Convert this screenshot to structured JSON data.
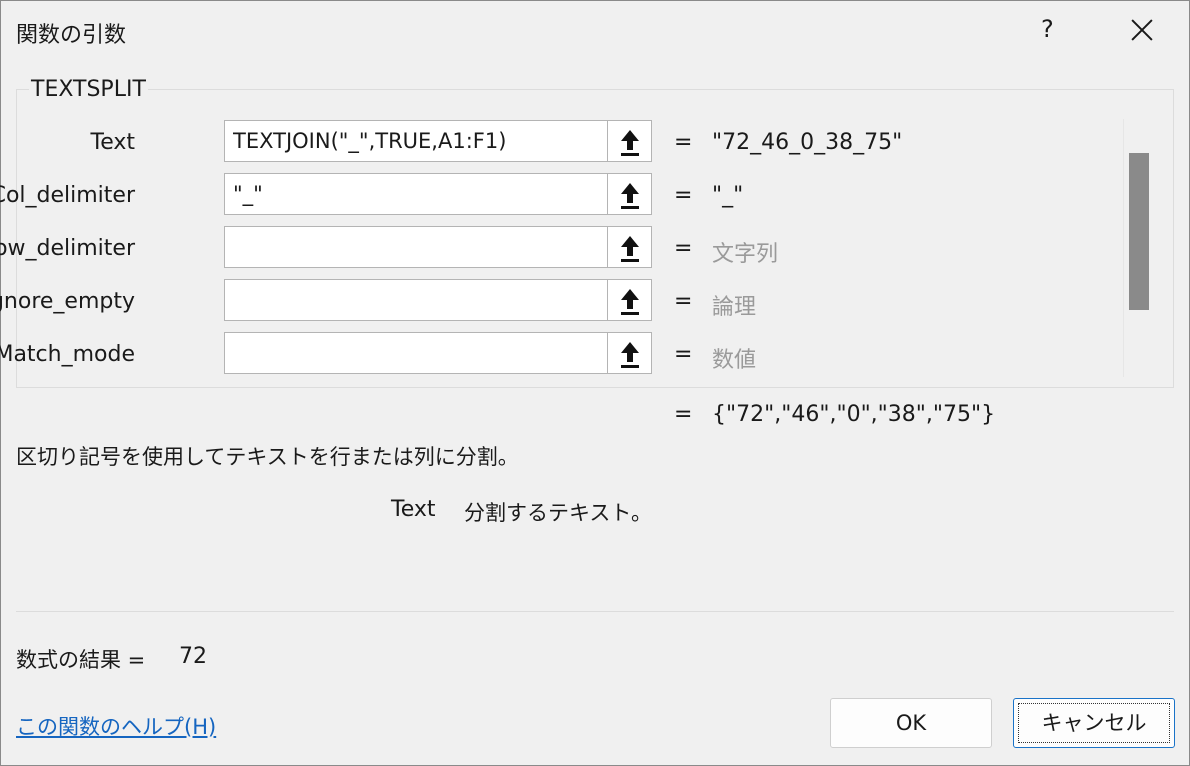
{
  "window": {
    "title": "関数の引数",
    "help_glyph": "?",
    "close_icon": "close-icon"
  },
  "function_name": "TEXTSPLIT",
  "arguments": [
    {
      "label": "Text",
      "value": "TEXTJOIN(\"_\",TRUE,A1:F1)",
      "equals": "=",
      "result": "\"72_46_0_38_75\"",
      "is_hint": false
    },
    {
      "label": "Col_delimiter",
      "value": "\"_\"",
      "equals": "=",
      "result": "\"_\"",
      "is_hint": false
    },
    {
      "label": "Row_delimiter",
      "value": "",
      "equals": "=",
      "result": "文字列",
      "is_hint": true
    },
    {
      "label": "Ignore_empty",
      "value": "",
      "equals": "=",
      "result": "論理",
      "is_hint": true
    },
    {
      "label": "Match_mode",
      "value": "",
      "equals": "=",
      "result": "数値",
      "is_hint": true
    }
  ],
  "function_result": {
    "equals": "=",
    "value": "{\"72\",\"46\",\"0\",\"38\",\"75\"}"
  },
  "description": "区切り記号を使用してテキストを行または列に分割。",
  "arg_help": {
    "name": "Text",
    "text": "分割するテキスト。"
  },
  "formula_result": {
    "label": "数式の結果 =",
    "value": "72"
  },
  "help_link": "この関数のヘルプ(H)",
  "buttons": {
    "ok": "OK",
    "cancel": "キャンセル"
  },
  "colors": {
    "link": "#1565c0",
    "hint_text": "#9a9a9a",
    "focus_border": "#1a73c8"
  }
}
